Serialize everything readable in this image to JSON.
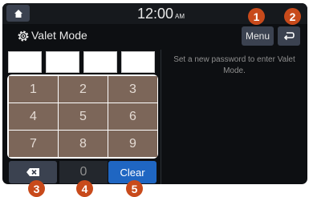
{
  "statusbar": {
    "home_icon": "home-icon",
    "time": "12:00",
    "ampm": "AM"
  },
  "header": {
    "title": "Valet Mode",
    "title_icon": "gear-icon",
    "menu_label": "Menu",
    "back_icon": "back-arrow-icon"
  },
  "password": {
    "slots": [
      "",
      "",
      "",
      ""
    ]
  },
  "keypad": {
    "keys": [
      "1",
      "2",
      "3",
      "4",
      "5",
      "6",
      "7",
      "8",
      "9"
    ],
    "zero": "0",
    "delete_icon": "backspace-icon",
    "clear_label": "Clear"
  },
  "info_text": "Set a new password to enter Valet Mode.",
  "callouts": [
    "1",
    "2",
    "3",
    "4",
    "5"
  ],
  "colors": {
    "screen_bg": "#0d0f12",
    "key_brown": "#7c6659",
    "button_gray": "#3b4250",
    "clear_blue": "#1f66c2",
    "callout_orange": "#c84a1b"
  }
}
